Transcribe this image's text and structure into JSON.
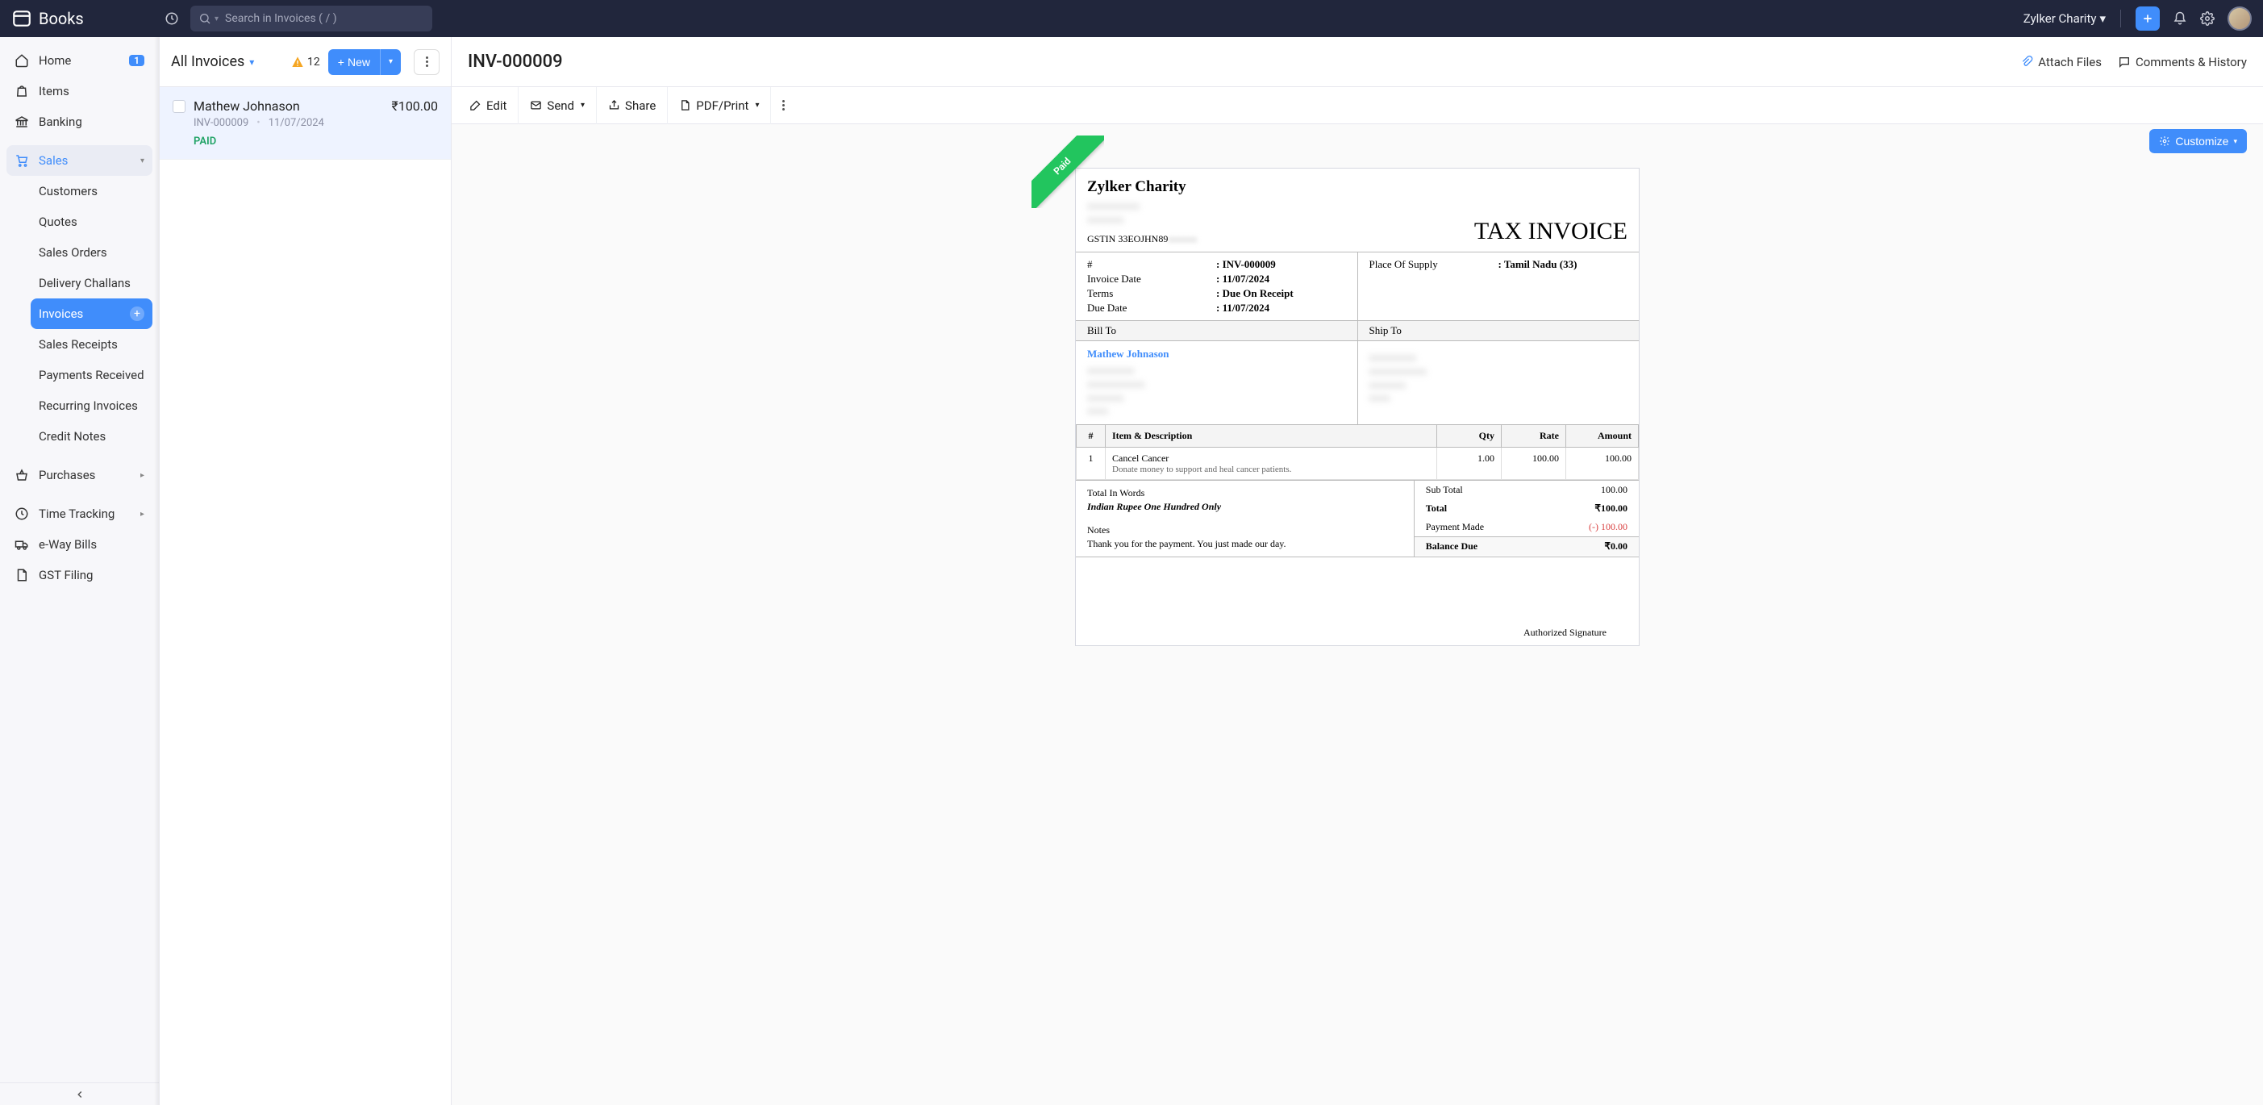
{
  "app_name": "Books",
  "search_placeholder": "Search in Invoices ( / )",
  "org_name": "Zylker Charity",
  "sidebar": {
    "home": "Home",
    "home_badge": "1",
    "items": "Items",
    "banking": "Banking",
    "sales": "Sales",
    "purchases": "Purchases",
    "time_tracking": "Time Tracking",
    "eway": "e-Way Bills",
    "gst": "GST Filing",
    "sales_children": {
      "customers": "Customers",
      "quotes": "Quotes",
      "sales_orders": "Sales Orders",
      "delivery": "Delivery Challans",
      "invoices": "Invoices",
      "receipts": "Sales Receipts",
      "payments": "Payments Received",
      "recurring": "Recurring Invoices",
      "credit": "Credit Notes"
    }
  },
  "list": {
    "title": "All Invoices",
    "warn_count": "12",
    "new_label": "New",
    "item": {
      "name": "Mathew Johnason",
      "amount": "₹100.00",
      "number": "INV-000009",
      "date": "11/07/2024",
      "status": "PAID"
    }
  },
  "detail": {
    "title": "INV-000009",
    "attach": "Attach Files",
    "comments": "Comments & History",
    "toolbar": {
      "edit": "Edit",
      "send": "Send",
      "share": "Share",
      "pdf": "PDF/Print"
    },
    "customize": "Customize",
    "ribbon": "Paid"
  },
  "invoice": {
    "company": "Zylker Charity",
    "gstin_label": "GSTIN",
    "gstin": "33EOJHN89",
    "heading": "TAX INVOICE",
    "meta": {
      "num_label": "#",
      "num": "INV-000009",
      "date_label": "Invoice Date",
      "date": "11/07/2024",
      "terms_label": "Terms",
      "terms": "Due On Receipt",
      "due_label": "Due Date",
      "due": "11/07/2024",
      "pos_label": "Place Of Supply",
      "pos": "Tamil Nadu (33)"
    },
    "billto_h": "Bill To",
    "shipto_h": "Ship To",
    "billto_name": "Mathew Johnason",
    "table": {
      "h_idx": "#",
      "h_item": "Item & Description",
      "h_qty": "Qty",
      "h_rate": "Rate",
      "h_amt": "Amount",
      "r1_idx": "1",
      "r1_item": "Cancel Cancer",
      "r1_desc": "Donate money to support and heal cancer patients.",
      "r1_qty": "1.00",
      "r1_rate": "100.00",
      "r1_amt": "100.00"
    },
    "totals": {
      "tiw_label": "Total In Words",
      "tiw": "Indian Rupee One Hundred Only",
      "notes_label": "Notes",
      "notes": "Thank you for the payment. You just made our day.",
      "subtotal_l": "Sub Total",
      "subtotal_v": "100.00",
      "total_l": "Total",
      "total_v": "₹100.00",
      "payment_l": "Payment Made",
      "payment_v": "(-) 100.00",
      "balance_l": "Balance Due",
      "balance_v": "₹0.00"
    },
    "auth_sig": "Authorized Signature"
  }
}
